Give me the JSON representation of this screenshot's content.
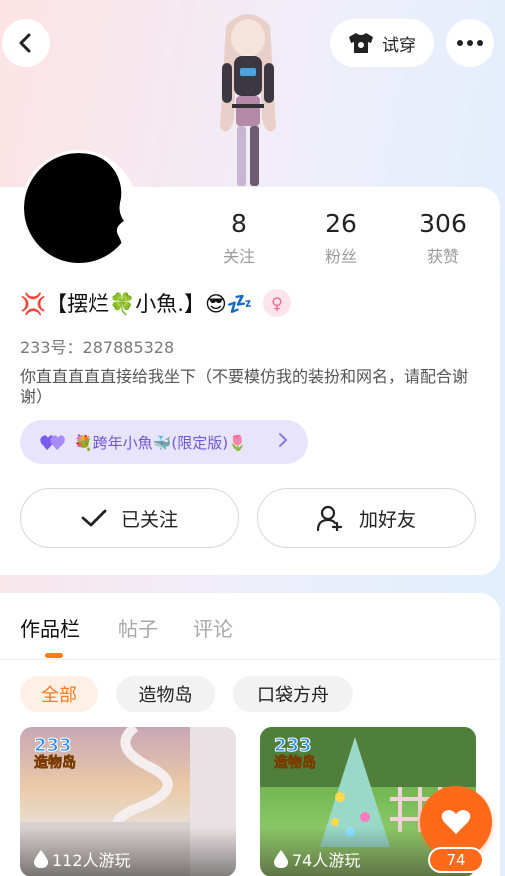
{
  "header": {
    "tryon_label": "试穿"
  },
  "stats": [
    {
      "num": "8",
      "label": "关注"
    },
    {
      "num": "26",
      "label": "粉丝"
    },
    {
      "num": "306",
      "label": "获赞"
    }
  ],
  "profile": {
    "name": "💢【摆烂🍀小魚.】😎💤",
    "uid": "233号：287885328",
    "bio": "你直直直直直接给我坐下（不要模仿我的装扮和网名，请配合谢谢）",
    "badge": "💐跨年小魚🐳(限定版)🌷"
  },
  "actions": {
    "follow": "已关注",
    "add_friend": "加好友"
  },
  "tabs": [
    "作品栏",
    "帖子",
    "评论"
  ],
  "chips": [
    "全部",
    "造物岛",
    "口袋方舟"
  ],
  "games": [
    {
      "logo_num": "233",
      "logo_text": "造物岛",
      "plays": "112人游玩"
    },
    {
      "logo_num": "233",
      "logo_text": "造物岛",
      "plays": "74人游玩"
    }
  ],
  "likes": "74",
  "colors": {
    "accent": "#ff7a1c",
    "badge_bg": "#e8e4fb",
    "badge_text": "#6f59d8"
  }
}
